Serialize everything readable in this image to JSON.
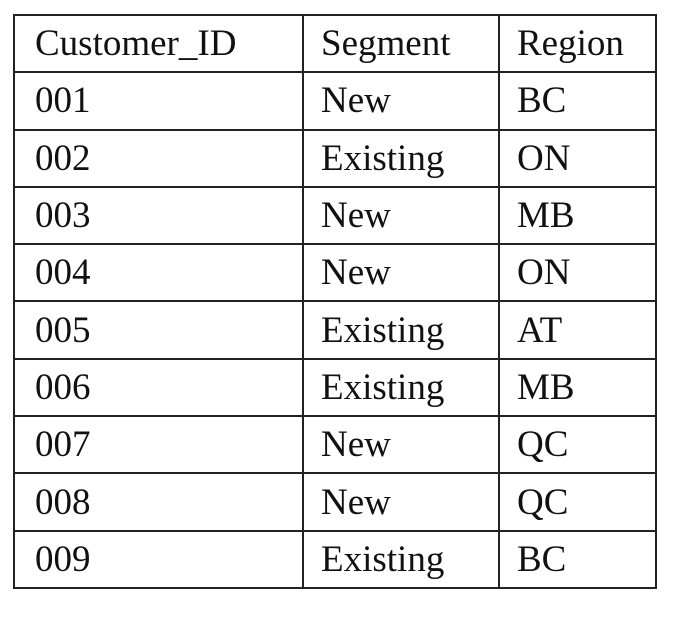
{
  "table": {
    "headers": [
      "Customer_ID",
      "Segment",
      "Region"
    ],
    "rows": [
      [
        "001",
        "New",
        "BC"
      ],
      [
        "002",
        "Existing",
        "ON"
      ],
      [
        "003",
        "New",
        "MB"
      ],
      [
        "004",
        "New",
        "ON"
      ],
      [
        "005",
        "Existing",
        "AT"
      ],
      [
        "006",
        "Existing",
        "MB"
      ],
      [
        "007",
        "New",
        "QC"
      ],
      [
        "008",
        "New",
        "QC"
      ],
      [
        "009",
        "Existing",
        "BC"
      ]
    ]
  }
}
